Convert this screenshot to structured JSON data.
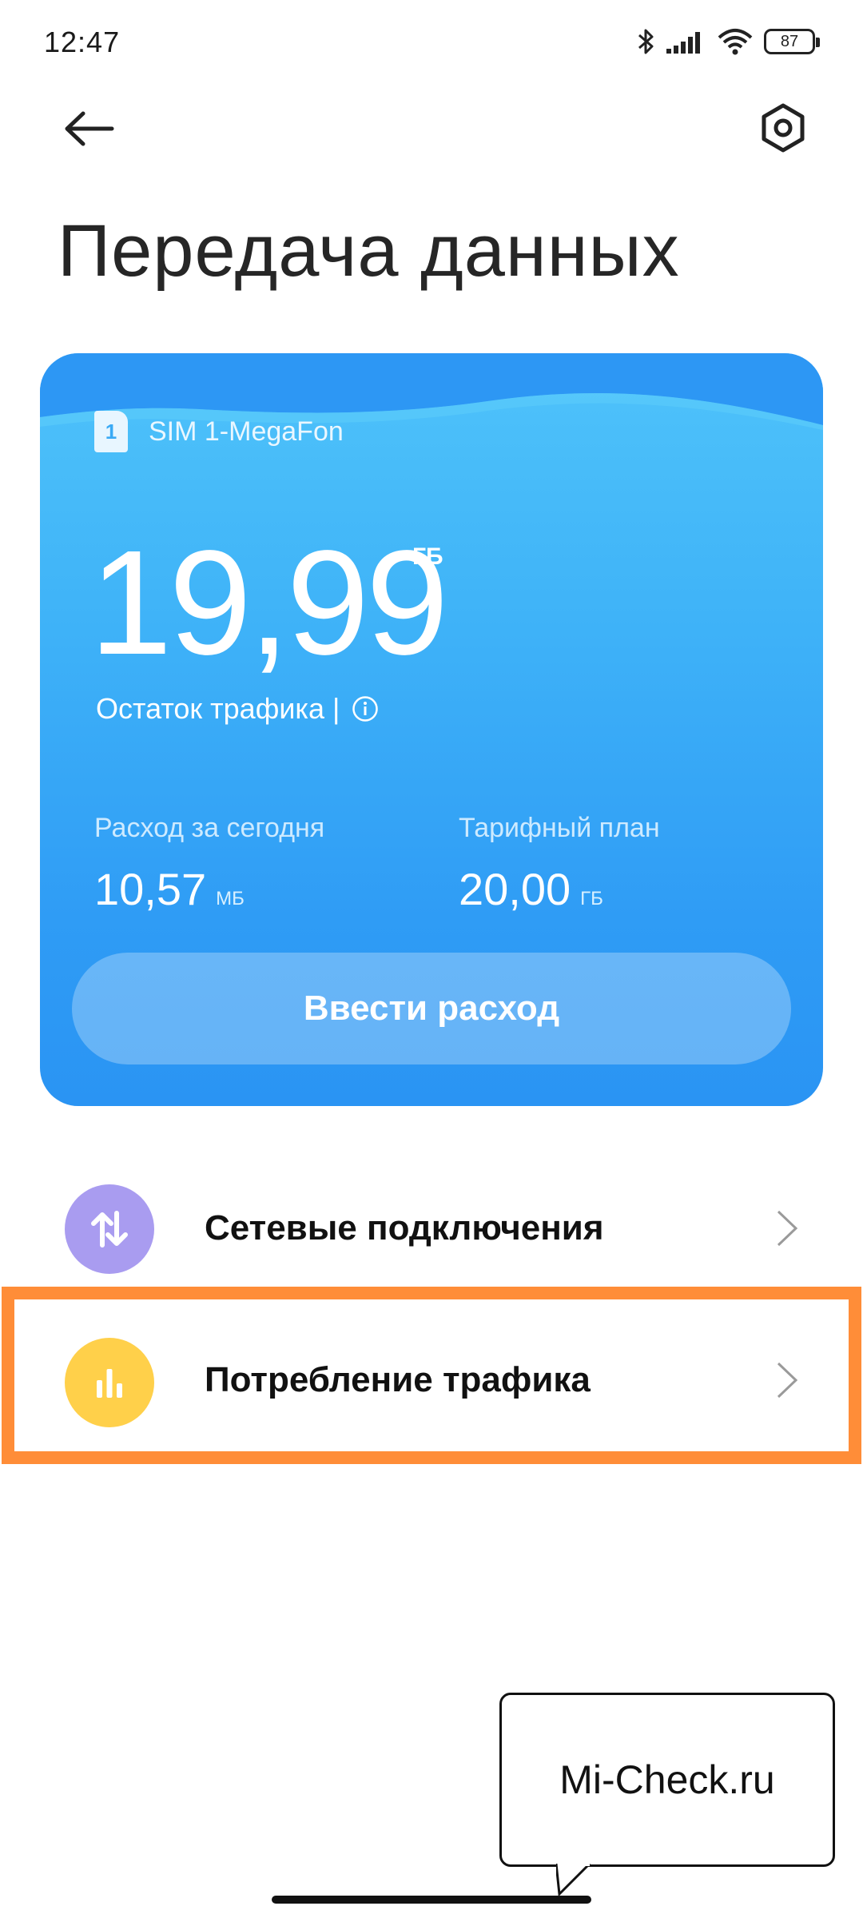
{
  "status_bar": {
    "time": "12:47",
    "battery": "87",
    "icons": [
      "bluetooth-icon",
      "signal-icon",
      "wifi-icon",
      "battery-icon"
    ]
  },
  "header": {
    "title": "Передача данных",
    "back_icon": "arrow-left-icon",
    "settings_icon": "gear-icon"
  },
  "card": {
    "sim_number": "1",
    "sim_label": "SIM 1-MegaFon",
    "remaining_value": "19,99",
    "remaining_unit": "ГБ",
    "remaining_label": "Остаток трафика |",
    "today_label": "Расход за сегодня",
    "today_value": "10,57",
    "today_unit": "МБ",
    "plan_label": "Тарифный план",
    "plan_value": "20,00",
    "plan_unit": "ГБ",
    "enter_button": "Ввести расход",
    "colors": {
      "top": "#4fc3fa",
      "bottom": "#2a94f3"
    }
  },
  "list": [
    {
      "label": "Сетевые подключения",
      "icon": "up-down-arrows-icon",
      "icon_color": "#a99cf0"
    },
    {
      "label": "Потребление трафика",
      "icon": "bar-chart-icon",
      "icon_color": "#ffd04a"
    }
  ],
  "highlight_color": "#ff8d38",
  "watermark": "Mi-Check.ru"
}
